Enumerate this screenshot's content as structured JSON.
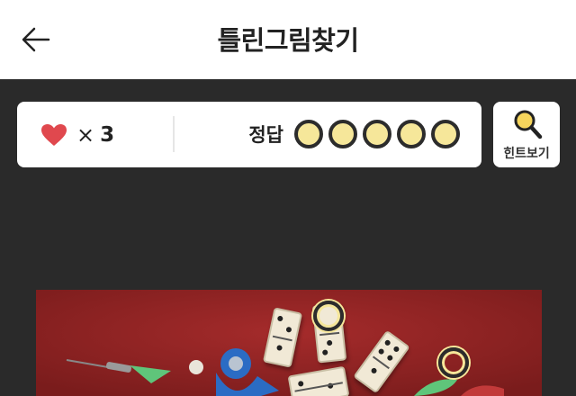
{
  "header": {
    "title": "틀린그림찾기",
    "back_icon": "arrow-left-icon"
  },
  "status": {
    "lives_icon": "heart-icon",
    "lives_icon_color": "#e0484e",
    "lives_multiplier": "×",
    "lives_count": "3",
    "answers_label": "정답",
    "answers_found": 0,
    "answers_total": 5,
    "slot_color": "#f6e79a"
  },
  "hint": {
    "icon": "magnifier-icon",
    "label": "힌트보기"
  },
  "puzzle": {
    "image": "board-game-items-photo",
    "background_color": "#8f2323",
    "found_markers": 2
  }
}
